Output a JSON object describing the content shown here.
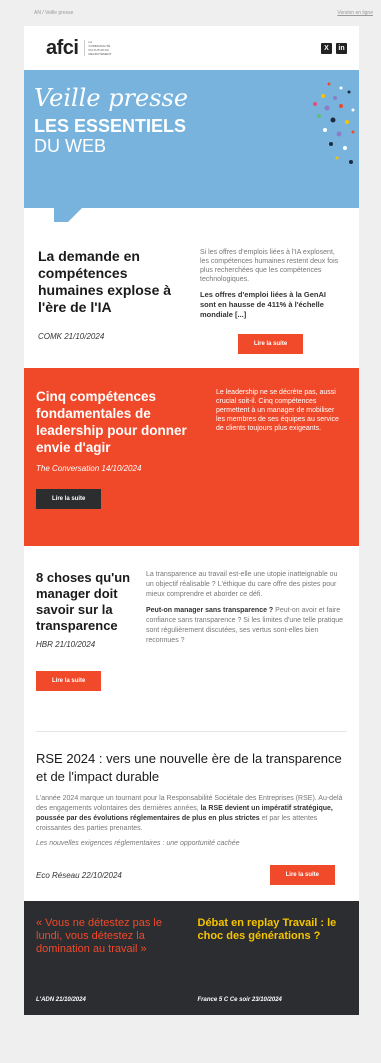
{
  "topbar": {
    "left": "AN / Veille presse",
    "right": "Version en ligne"
  },
  "header": {
    "logo_text": "afci",
    "logo_tagline": "LA COMMUNAUTÉ DU FUTUR DU RECRUTEMENT",
    "socials": [
      "X",
      "in"
    ]
  },
  "banner": {
    "script_title": "Veille presse",
    "title_line1": "LES ESSENTIELS",
    "title_line2": "DU WEB"
  },
  "articles": [
    {
      "title": "La demande en compétences humaines explose à l'ère de l'IA",
      "source": "COMK 21/10/2024",
      "desc": "Si les offres d'emplois liées à l'IA explosent, les compétences humaines restent deux fois plus recherchées que les compétences technologiques.",
      "highlight": "Les offres d'emploi liées à la GenAI sont en hausse de 411% à l'échelle mondiale [...]",
      "button": "Lire la suite"
    },
    {
      "title": "Cinq compétences fondamentales de leadership pour donner envie d'agir",
      "source": "The Conversation 14/10/2024",
      "desc": "Le leadership ne se décrète pas, aussi crucial soit-il. Cinq compétences permettent à un manager de mobiliser les membres de ses équipes au service de clients toujours plus exigeants.",
      "button": "Lire la suite"
    },
    {
      "title": "8 choses qu'un manager doit savoir sur la transparence",
      "source": "HBR 21/10/2024",
      "desc": "La transparence au travail est-elle une utopie inatteignable ou un objectif réalisable ? L'éthique du care offre des pistes pour mieux comprendre et aborder ce défi.",
      "p2_bold": "Peut-on manager sans transparence ?",
      "p2_rest": " Peut-on avoir et faire confiance sans transparence ? Si les limites d'une telle pratique sont régulièrement discutées, ses vertus sont-elles bien reconnues ?",
      "button": "Lire la suite"
    },
    {
      "title": "RSE 2024 : vers une nouvelle ère de la transparence et de l'impact durable",
      "body_start": "L'année 2024 marque un tournant pour la Responsabilité Sociétale des Entreprises (RSE). Au-delà des engagements volontaires des dernières années, ",
      "body_bold": "la RSE devient un impératif stratégique, poussée par des évolutions réglementaires de plus en plus strictes",
      "body_end": " et par les attentes croissantes des parties prenantes.",
      "note": "Les nouvelles exigences réglementaires : une opportunité cachée",
      "source": "Eco Réseau 22/10/2024",
      "button": "Lire la suite"
    }
  ],
  "bottom": {
    "left_quote": "« Vous ne détestez pas le lundi, vous détestez la domination au travail »",
    "left_source": "L'ADN 21/10/2024",
    "right_title": "Débat en replay Travail : le choc des générations ?",
    "right_source": "France 5 C Ce soir 23/10/2024"
  },
  "colors": {
    "accent": "#f0492a",
    "banner": "#78b3dd",
    "dark": "#2b2d30",
    "yellow": "#f5c400"
  }
}
